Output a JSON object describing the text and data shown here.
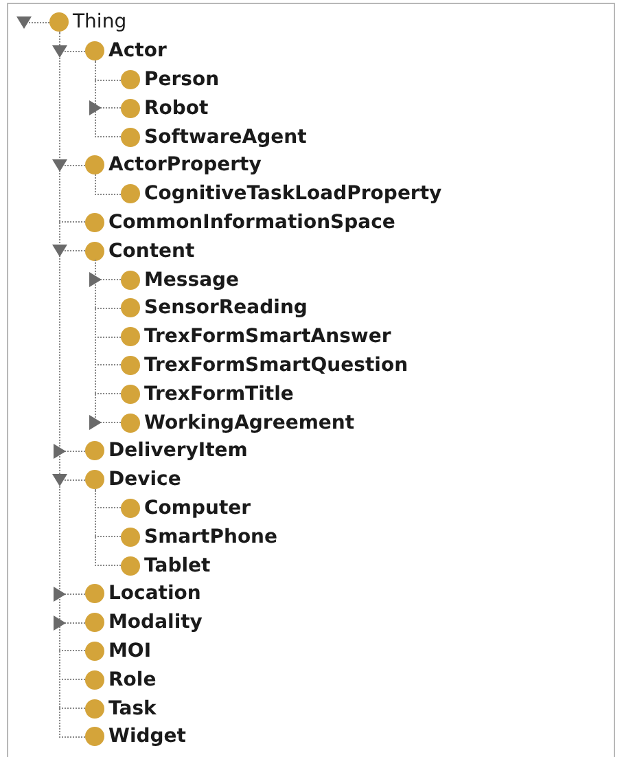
{
  "tree": [
    {
      "label": "Thing",
      "expanded": true,
      "children": [
        {
          "label": "Actor",
          "expanded": true,
          "children": [
            {
              "label": "Person"
            },
            {
              "label": "Robot",
              "expanded": false
            },
            {
              "label": "SoftwareAgent"
            }
          ]
        },
        {
          "label": "ActorProperty",
          "expanded": true,
          "children": [
            {
              "label": "CognitiveTaskLoadProperty"
            }
          ]
        },
        {
          "label": "CommonInformationSpace"
        },
        {
          "label": "Content",
          "expanded": true,
          "children": [
            {
              "label": "Message",
              "expanded": false
            },
            {
              "label": "SensorReading"
            },
            {
              "label": "TrexFormSmartAnswer"
            },
            {
              "label": "TrexFormSmartQuestion"
            },
            {
              "label": "TrexFormTitle"
            },
            {
              "label": "WorkingAgreement",
              "expanded": false
            }
          ]
        },
        {
          "label": "DeliveryItem",
          "expanded": false
        },
        {
          "label": "Device",
          "expanded": true,
          "children": [
            {
              "label": "Computer"
            },
            {
              "label": "SmartPhone"
            },
            {
              "label": "Tablet"
            }
          ]
        },
        {
          "label": "Location",
          "expanded": false
        },
        {
          "label": "Modality",
          "expanded": false
        },
        {
          "label": "MOI"
        },
        {
          "label": "Role"
        },
        {
          "label": "Task"
        },
        {
          "label": "Widget"
        }
      ]
    }
  ]
}
